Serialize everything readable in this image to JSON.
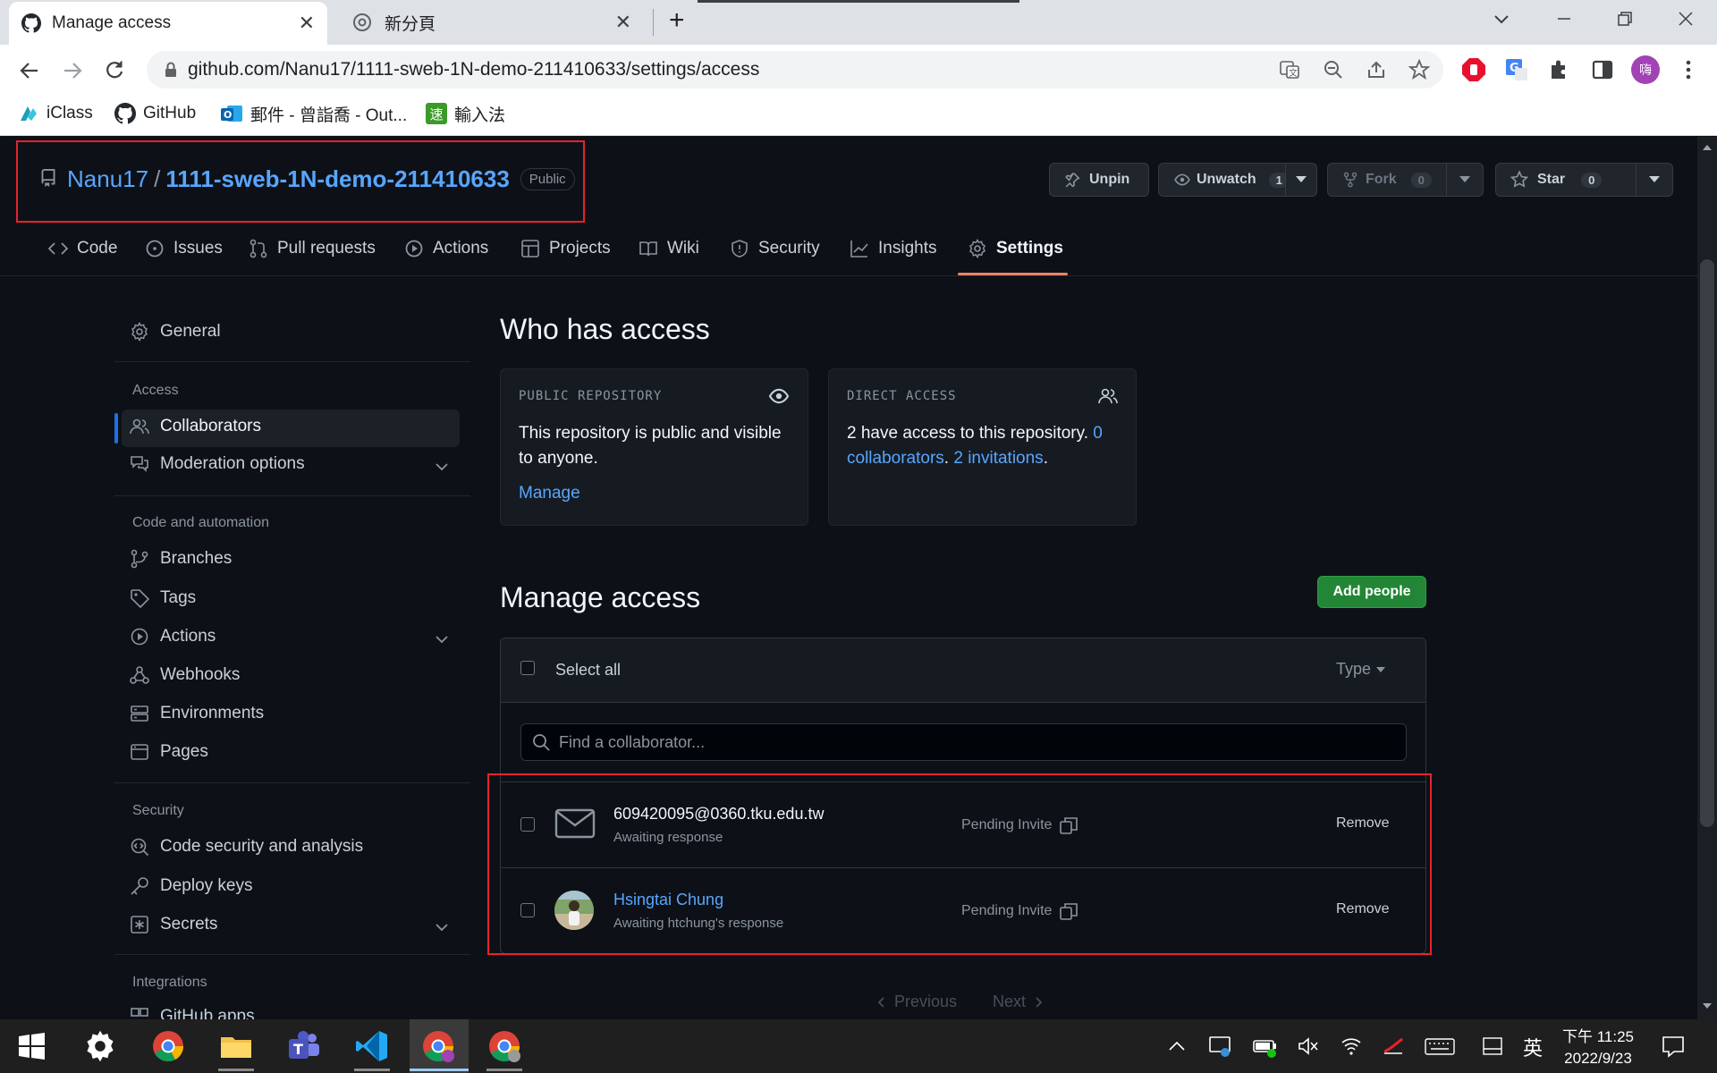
{
  "browser": {
    "tabs": [
      {
        "title": "Manage access",
        "close": "✕"
      },
      {
        "title": "新分頁",
        "close": "✕"
      }
    ],
    "new_tab": "+",
    "url": "github.com/Nanu17/1111-sweb-1N-demo-211410633/settings/access",
    "bookmarks": [
      {
        "label": "iClass"
      },
      {
        "label": "GitHub"
      },
      {
        "label": "郵件 - 曾詣喬 - Out..."
      },
      {
        "label": "輸入法",
        "badge": "速"
      }
    ],
    "profile_initial": "嗨"
  },
  "repo": {
    "owner": "Nanu17",
    "sep": "/",
    "name": "1111-sweb-1N-demo-211410633",
    "visibility": "Public",
    "actions": {
      "unpin": "Unpin",
      "unwatch": "Unwatch",
      "watch_count": "1",
      "fork": "Fork",
      "fork_count": "0",
      "star": "Star",
      "star_count": "0"
    }
  },
  "nav": [
    {
      "label": "Code",
      "icon": "code-icon"
    },
    {
      "label": "Issues",
      "icon": "issue-icon"
    },
    {
      "label": "Pull requests",
      "icon": "pull-request-icon"
    },
    {
      "label": "Actions",
      "icon": "play-icon"
    },
    {
      "label": "Projects",
      "icon": "table-icon"
    },
    {
      "label": "Wiki",
      "icon": "book-icon"
    },
    {
      "label": "Security",
      "icon": "shield-icon"
    },
    {
      "label": "Insights",
      "icon": "graph-icon"
    },
    {
      "label": "Settings",
      "icon": "gear-icon",
      "active": true
    }
  ],
  "sidebar": {
    "general": "General",
    "access_heading": "Access",
    "collaborators": "Collaborators",
    "moderation": "Moderation options",
    "code_heading": "Code and automation",
    "branches": "Branches",
    "tags": "Tags",
    "actions": "Actions",
    "webhooks": "Webhooks",
    "environments": "Environments",
    "pages": "Pages",
    "security_heading": "Security",
    "code_security": "Code security and analysis",
    "deploy_keys": "Deploy keys",
    "secrets": "Secrets",
    "integrations_heading": "Integrations",
    "github_apps": "GitHub apps"
  },
  "who": {
    "title": "Who has access",
    "public_label": "PUBLIC REPOSITORY",
    "public_text": "This repository is public and visible to anyone.",
    "manage": "Manage",
    "direct_label": "DIRECT ACCESS",
    "direct_text_1": "2 have access to this repository. ",
    "direct_link_1": "0 collaborators",
    "direct_text_2": ". ",
    "direct_link_2": "2 invitations",
    "direct_text_3": "."
  },
  "manage": {
    "title": "Manage access",
    "add_people": "Add people",
    "select_all": "Select all",
    "type": "Type",
    "search_placeholder": "Find a collaborator...",
    "rows": [
      {
        "name": "609420095@0360.tku.edu.tw",
        "sub": "Awaiting response",
        "status": "Pending Invite",
        "remove": "Remove"
      },
      {
        "name": "Hsingtai Chung",
        "sub": "Awaiting htchung's response",
        "status": "Pending Invite",
        "remove": "Remove"
      }
    ],
    "previous": "Previous",
    "next": "Next"
  },
  "taskbar": {
    "ime": "英",
    "time": "下午 11:25",
    "date": "2022/9/23"
  },
  "colors": {
    "accent_link": "#58a6ff",
    "green_button": "#238636",
    "active_tab_underline": "#f78166",
    "annotation_red": "#e5242a"
  }
}
